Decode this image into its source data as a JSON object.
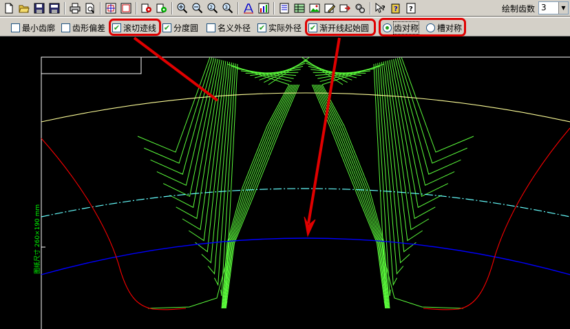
{
  "toolbar": {
    "icons": [
      "new-file-icon",
      "open-folder-icon",
      "save-icon",
      "save-default-icon",
      "print-icon",
      "print-preview-icon",
      "fit-view-icon",
      "window-icon",
      "gear-settings-icon",
      "gear-settings-alt-icon",
      "zoom-in-icon",
      "zoom-window-icon",
      "zoom-2-icon",
      "zoom-3-icon",
      "text-icon",
      "chart-icon",
      "report-icon",
      "table-icon",
      "image-icon",
      "edit-icon",
      "export-icon",
      "tools-icon",
      "help-pointer-icon",
      "help-book-icon",
      "about-icon"
    ],
    "count_label": "绘制齿数",
    "count_value": "3"
  },
  "options": {
    "min_profile": {
      "label": "最小齿廓",
      "checked": false
    },
    "profile_deviation": {
      "label": "齿形偏差",
      "checked": false
    },
    "hob_path": {
      "label": "滚切迹线",
      "checked": true
    },
    "pitch_circle": {
      "label": "分度圆",
      "checked": true
    },
    "nominal_od": {
      "label": "名义外径",
      "checked": false
    },
    "actual_od": {
      "label": "实际外径",
      "checked": true
    },
    "involute_start": {
      "label": "渐开线起始圆",
      "checked": true
    },
    "tooth_symmetric": {
      "label": "齿对称",
      "selected": true
    },
    "slot_symmetric": {
      "label": "槽对称",
      "selected": false
    }
  },
  "canvas": {
    "dimension_label": "图纸尺寸  260×190  mm",
    "colors": {
      "background": "#000000",
      "hob_paths": "#5cff3c",
      "actual_od": "#ffff99",
      "pitch_circle": "#66ffff",
      "involute_start": "#0000ff",
      "tooth_outline": "#ff0000",
      "frame": "#ffffff",
      "annotation": "#ff0000"
    }
  }
}
